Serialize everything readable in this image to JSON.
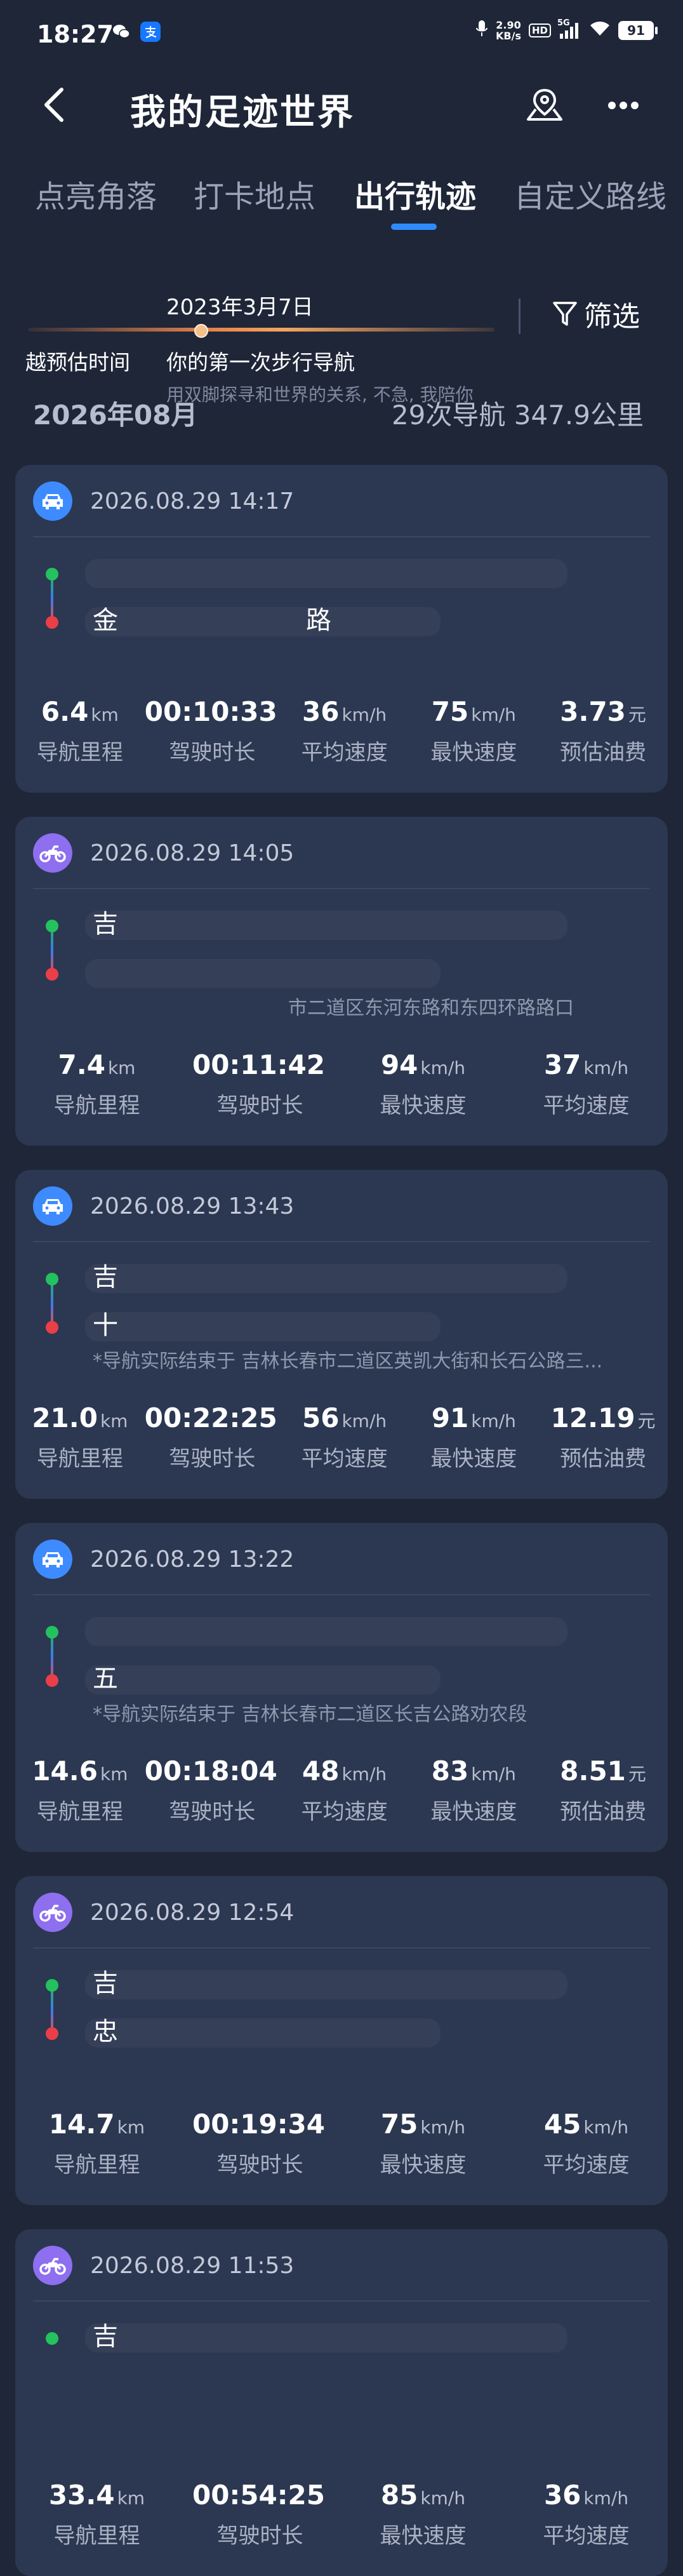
{
  "status_bar": {
    "time": "18:27",
    "net_speed_value": "2.90",
    "net_speed_unit": "KB/s",
    "hd": "HD",
    "network": "5G",
    "battery": "91"
  },
  "header": {
    "title": "我的足迹世界"
  },
  "tabs": [
    {
      "label": "点亮角落"
    },
    {
      "label": "打卡地点"
    },
    {
      "label": "出行轨迹",
      "active": true
    },
    {
      "label": "自定义路线"
    }
  ],
  "timeline": {
    "date": "2023年3月7日",
    "left_label": "越预估时间",
    "event_title": "你的第一次步行导航",
    "event_subtitle": "用双脚探寻和世界的关系, 不急, 我陪你",
    "filter_label": "筛选"
  },
  "month": {
    "label": "2026年08月",
    "summary": "29次导航 347.9公里"
  },
  "trips": [
    {
      "vehicle": "car",
      "date": "2026.08.29 14:17",
      "start": "",
      "end": "金",
      "end_tail": "路",
      "note": "",
      "stats": [
        {
          "value": "6.4",
          "unit": "km",
          "label": "导航里程"
        },
        {
          "value": "00:10:33",
          "unit": "",
          "label": "驾驶时长"
        },
        {
          "value": "36",
          "unit": "km/h",
          "label": "平均速度"
        },
        {
          "value": "75",
          "unit": "km/h",
          "label": "最快速度"
        },
        {
          "value": "3.73",
          "unit": "元",
          "label": "预估油费"
        }
      ]
    },
    {
      "vehicle": "moto",
      "date": "2026.08.29 14:05",
      "start": "吉",
      "end": "",
      "end_tail": "",
      "note": "市二道区东河东路和东四环路路口",
      "stats": [
        {
          "value": "7.4",
          "unit": "km",
          "label": "导航里程"
        },
        {
          "value": "00:11:42",
          "unit": "",
          "label": "驾驶时长"
        },
        {
          "value": "94",
          "unit": "km/h",
          "label": "最快速度"
        },
        {
          "value": "37",
          "unit": "km/h",
          "label": "平均速度"
        }
      ]
    },
    {
      "vehicle": "car",
      "date": "2026.08.29 13:43",
      "start": "吉",
      "end": "十",
      "end_tail": "",
      "note": "*导航实际结束于 吉林长春市二道区英凯大街和长石公路三...",
      "stats": [
        {
          "value": "21.0",
          "unit": "km",
          "label": "导航里程"
        },
        {
          "value": "00:22:25",
          "unit": "",
          "label": "驾驶时长"
        },
        {
          "value": "56",
          "unit": "km/h",
          "label": "平均速度"
        },
        {
          "value": "91",
          "unit": "km/h",
          "label": "最快速度"
        },
        {
          "value": "12.19",
          "unit": "元",
          "label": "预估油费"
        }
      ]
    },
    {
      "vehicle": "car",
      "date": "2026.08.29 13:22",
      "start": "",
      "end": "五",
      "end_tail": "",
      "note": "*导航实际结束于 吉林长春市二道区长吉公路劝农段",
      "stats": [
        {
          "value": "14.6",
          "unit": "km",
          "label": "导航里程"
        },
        {
          "value": "00:18:04",
          "unit": "",
          "label": "驾驶时长"
        },
        {
          "value": "48",
          "unit": "km/h",
          "label": "平均速度"
        },
        {
          "value": "83",
          "unit": "km/h",
          "label": "最快速度"
        },
        {
          "value": "8.51",
          "unit": "元",
          "label": "预估油费"
        }
      ]
    },
    {
      "vehicle": "moto",
      "date": "2026.08.29 12:54",
      "start": "吉",
      "end": "忠",
      "end_tail": "",
      "note": "",
      "stats": [
        {
          "value": "14.7",
          "unit": "km",
          "label": "导航里程"
        },
        {
          "value": "00:19:34",
          "unit": "",
          "label": "驾驶时长"
        },
        {
          "value": "75",
          "unit": "km/h",
          "label": "最快速度"
        },
        {
          "value": "45",
          "unit": "km/h",
          "label": "平均速度"
        }
      ]
    },
    {
      "vehicle": "moto",
      "date": "2026.08.29 11:53",
      "start": "吉",
      "end": "",
      "end_tail": "",
      "note": "",
      "stats": [
        {
          "value": "33.4",
          "unit": "km",
          "label": "导航里程"
        },
        {
          "value": "00:54:25",
          "unit": "",
          "label": "驾驶时长"
        },
        {
          "value": "85",
          "unit": "km/h",
          "label": "最快速度"
        },
        {
          "value": "36",
          "unit": "km/h",
          "label": "平均速度"
        }
      ]
    }
  ]
}
